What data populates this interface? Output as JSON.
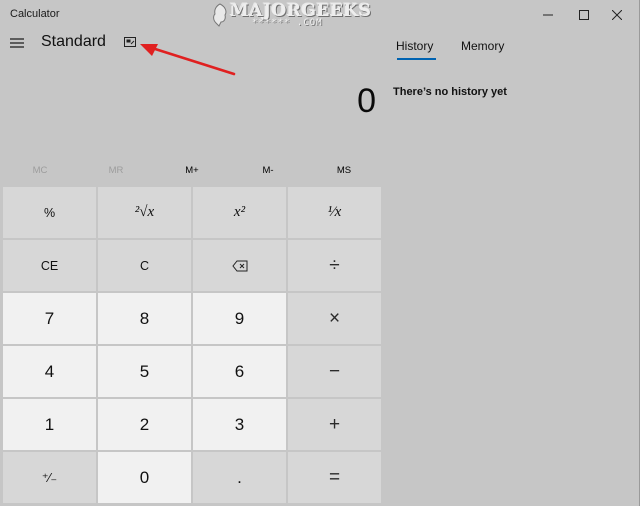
{
  "window": {
    "title": "Calculator",
    "controls": {
      "minimize_icon": "minimize-icon",
      "maximize_icon": "maximize-icon",
      "close_icon": "close-icon"
    }
  },
  "watermark": {
    "text": "MAJORGEEKS",
    "subtext": "****** .COM"
  },
  "header": {
    "menu_icon": "hamburger-icon",
    "mode": "Standard",
    "ontop_icon": "keep-on-top-icon"
  },
  "display": {
    "value": "0"
  },
  "memory": {
    "buttons": [
      {
        "label": "MC",
        "enabled": false
      },
      {
        "label": "MR",
        "enabled": false
      },
      {
        "label": "M+",
        "enabled": true
      },
      {
        "label": "M-",
        "enabled": true
      },
      {
        "label": "MS",
        "enabled": true
      }
    ]
  },
  "keypad": {
    "rows": [
      [
        "%",
        "²√x",
        "x²",
        "¹⁄x"
      ],
      [
        "CE",
        "C",
        "backspace",
        "÷"
      ],
      [
        "7",
        "8",
        "9",
        "×"
      ],
      [
        "4",
        "5",
        "6",
        "−"
      ],
      [
        "1",
        "2",
        "3",
        "+"
      ],
      [
        "⁺⁄₋",
        "0",
        ".",
        "="
      ]
    ]
  },
  "panel": {
    "tabs": [
      "History",
      "Memory"
    ],
    "active_tab": "History",
    "empty_message": "There’s no history yet"
  },
  "colors": {
    "accent": "#0063b1",
    "annotation": "#e02020"
  }
}
